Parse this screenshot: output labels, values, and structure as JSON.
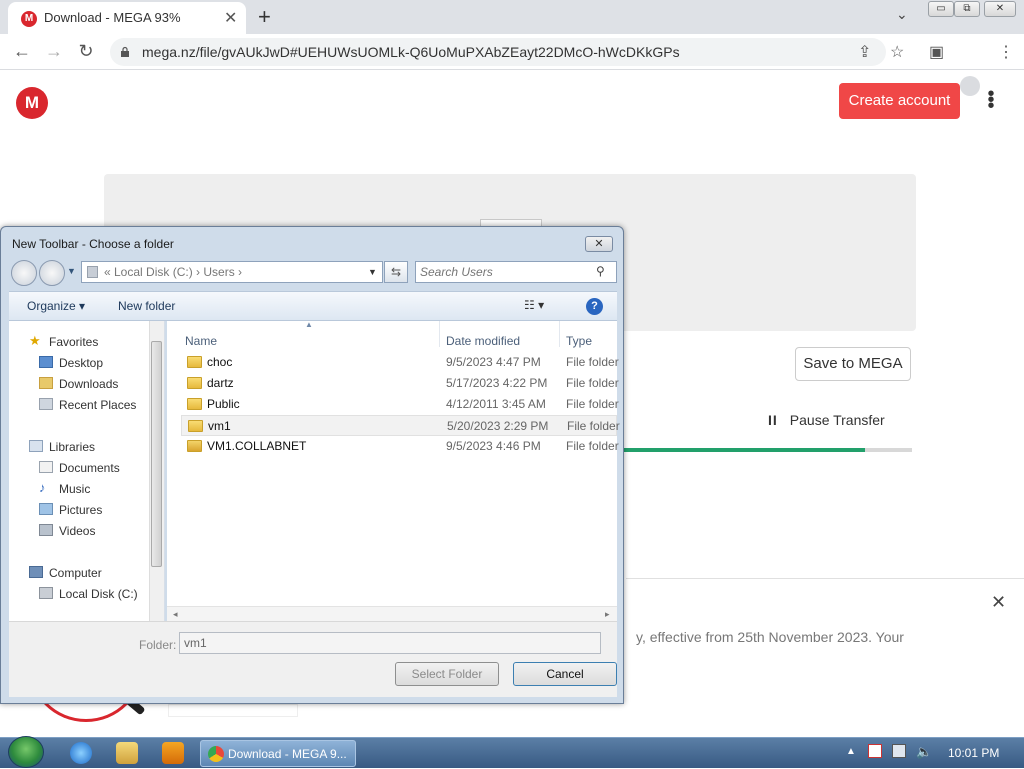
{
  "browser": {
    "tab_title": "Download - MEGA 93%",
    "tab_favicon": "M",
    "tab_close": "✕",
    "new_tab": "+",
    "tab_list": "⌄",
    "url": "mega.nz/file/gvAUkJwD#UEHUWsUOMLk-Q6UoMuPXAbZEayt22DMcO-hWcDKkGPs",
    "window_controls": {
      "minimize": "▭",
      "restore": "⧉",
      "close": "✕"
    }
  },
  "page": {
    "logo_letter": "M",
    "create_account": "Create account",
    "menu": "⋮",
    "save_to_mega": "Save to MEGA",
    "pause_icon": "II",
    "pause_transfer": "Pause Transfer",
    "progress": 0.84,
    "cookie_text": "y, effective from 25th November 2023. Your",
    "cookie_close": "✕",
    "accent_color": "#d9272e",
    "progress_color": "#22a06b"
  },
  "dialog": {
    "title": "New Toolbar - Choose a folder",
    "close": "✕",
    "breadcrumb": "«  Local Disk (C:)  ›  Users  ›",
    "search_placeholder": "Search Users",
    "organize": "Organize ▾",
    "new_folder": "New folder",
    "views_icon": "☷ ▾",
    "help": "?",
    "nav": {
      "favorites": "Favorites",
      "desktop": "Desktop",
      "downloads": "Downloads",
      "recent_places": "Recent Places",
      "libraries": "Libraries",
      "documents": "Documents",
      "music": "Music",
      "pictures": "Pictures",
      "videos": "Videos",
      "computer": "Computer",
      "local_disk": "Local Disk (C:)"
    },
    "columns": {
      "name": "Name",
      "date": "Date modified",
      "type": "Type"
    },
    "files": [
      {
        "name": "choc",
        "date": "9/5/2023 4:47 PM",
        "type": "File folder"
      },
      {
        "name": "dartz",
        "date": "5/17/2023 4:22 PM",
        "type": "File folder"
      },
      {
        "name": "Public",
        "date": "4/12/2011 3:45 AM",
        "type": "File folder"
      },
      {
        "name": "vm1",
        "date": "5/20/2023 2:29 PM",
        "type": "File folder"
      },
      {
        "name": "VM1.COLLABNET",
        "date": "9/5/2023 4:46 PM",
        "type": "File folder"
      }
    ],
    "folder_label": "Folder:",
    "folder_value": "vm1",
    "select_folder": "Select Folder",
    "cancel": "Cancel"
  },
  "taskbar": {
    "chrome_task": "Download - MEGA 9...",
    "clock": "10:01 PM"
  }
}
